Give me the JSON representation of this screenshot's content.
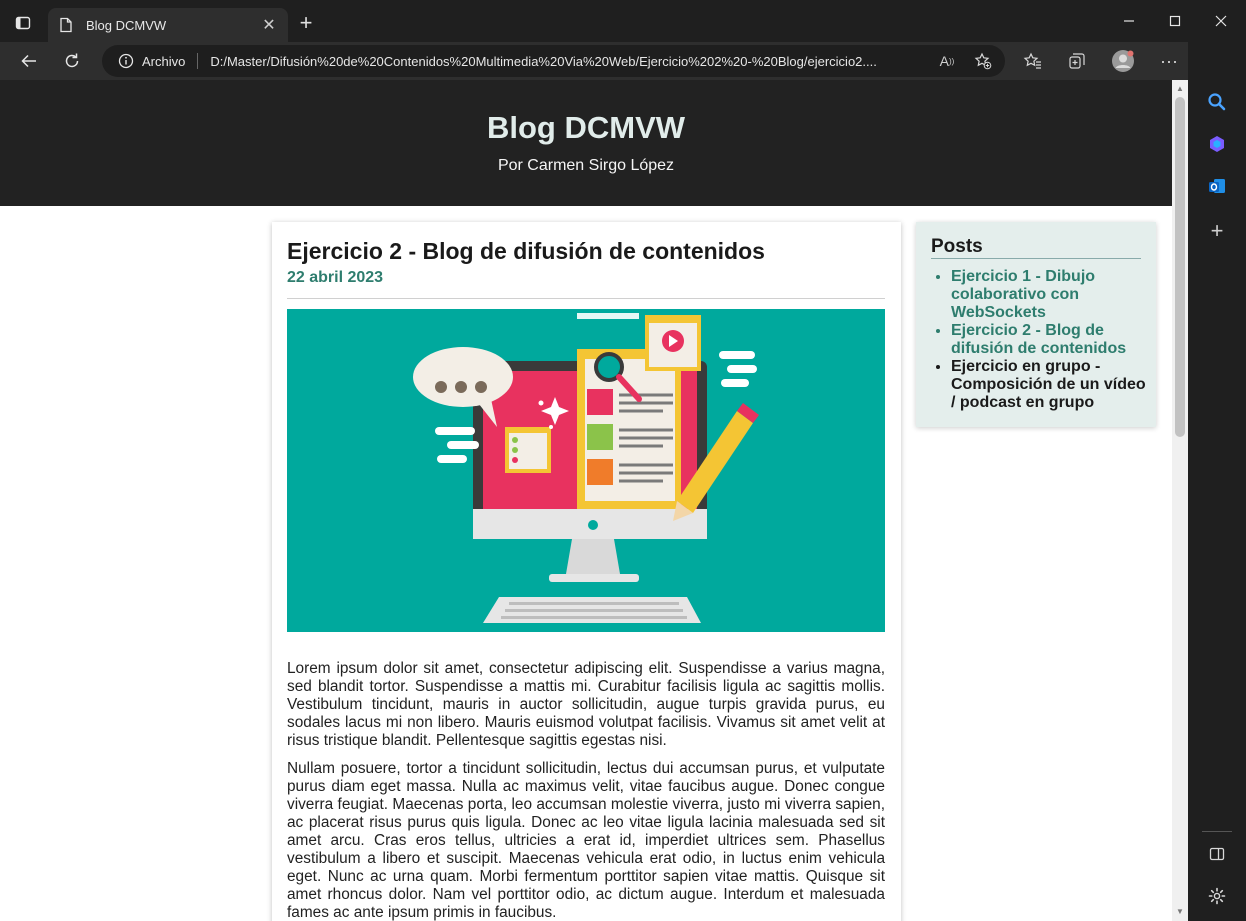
{
  "browser": {
    "tab_title": "Blog DCMVW",
    "new_tab_symbol": "+",
    "address_prefix": "Archivo",
    "url": "D:/Master/Difusión%20de%20Contenidos%20Multimedia%20Via%20Web/Ejercicio%202%20-%20Blog/ejercicio2....",
    "icons": [
      "tab-actions-icon",
      "page-icon",
      "close-icon",
      "back-icon",
      "refresh-icon",
      "info-icon",
      "read-aloud-icon",
      "add-favorite-icon",
      "favorites-icon",
      "collections-icon",
      "profile-icon",
      "more-icon",
      "bing-icon",
      "minimize-icon",
      "maximize-icon",
      "window-close-icon"
    ]
  },
  "edge_sidebar": {
    "icons": [
      "search-icon",
      "copilot-icon",
      "outlook-icon",
      "add-icon",
      "split-screen-icon",
      "settings-icon"
    ]
  },
  "blog": {
    "title": "Blog DCMVW",
    "author": "Por Carmen Sirgo López"
  },
  "post": {
    "title": "Ejercicio 2 - Blog de difusión de contenidos",
    "date": "22 abril 2023",
    "paragraphs": [
      "Lorem ipsum dolor sit amet, consectetur adipiscing elit. Suspendisse a varius magna, sed blandit tortor. Suspendisse a mattis mi. Curabitur facilisis ligula ac sagittis mollis. Vestibulum tincidunt, mauris in auctor sollicitudin, augue turpis gravida purus, eu sodales lacus mi non libero. Mauris euismod volutpat facilisis. Vivamus sit amet velit at risus tristique blandit. Pellentesque sagittis egestas nisi.",
      "Nullam posuere, tortor a tincidunt sollicitudin, lectus dui accumsan purus, et vulputate purus diam eget massa. Nulla ac maximus velit, vitae faucibus augue. Donec congue viverra feugiat. Maecenas porta, leo accumsan molestie viverra, justo mi viverra sapien, ac placerat risus purus quis ligula. Donec ac leo vitae ligula lacinia malesuada sed sit amet arcu. Cras eros tellus, ultricies a erat id, imperdiet ultrices sem. Phasellus vestibulum a libero et suscipit. Maecenas vehicula erat odio, in luctus enim vehicula eget. Nunc ac urna quam. Morbi fermentum porttitor sapien vitae mattis. Quisque sit amet rhoncus dolor. Nam vel porttitor odio, ac dictum augue. Interdum et malesuada fames ac ante ipsum primis in faucibus."
    ]
  },
  "sidebar": {
    "title": "Posts",
    "items": [
      {
        "label": "Ejercicio 1 - Dibujo colaborativo con WebSockets"
      },
      {
        "label": "Ejercicio 2 - Blog de difusión de contenidos"
      },
      {
        "label": "Ejercicio en grupo - Composición de un vídeo / podcast en grupo"
      }
    ]
  },
  "colors": {
    "header_bg": "#222222",
    "accent": "#2e7d6e",
    "sidebar_bg": "#e4eeec",
    "image_bg": "#00a99d"
  }
}
